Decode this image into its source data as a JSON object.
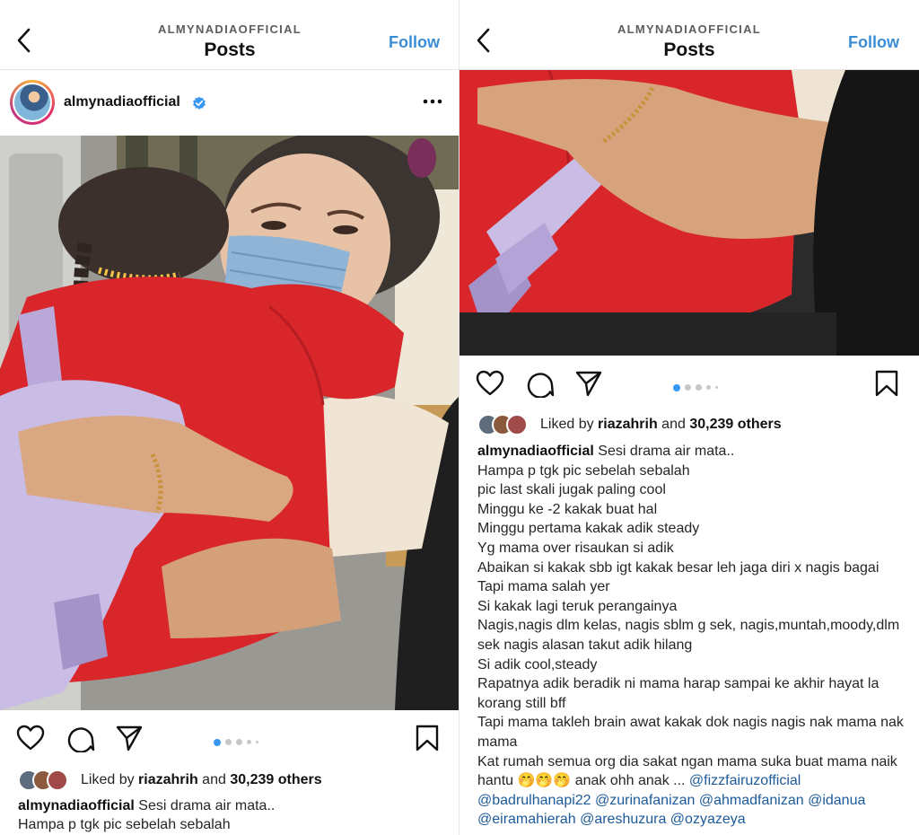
{
  "header": {
    "username": "ALMYNADIAOFFICIAL",
    "title": "Posts",
    "follow_label": "Follow"
  },
  "post": {
    "username": "almynadiaofficial",
    "liked_by_prefix": "Liked by ",
    "liked_by_user": "riazahrih",
    "liked_by_and": " and ",
    "liked_by_count": "30,239 others",
    "carousel": {
      "total": 5,
      "current_left": 1,
      "current_right": 1
    }
  },
  "caption": {
    "username": "almynadiaofficial",
    "lines": [
      "Sesi drama air mata..",
      "Hampa p tgk pic sebelah sebalah",
      "pic last skali jugak paling cool",
      "Minggu ke -2 kakak buat hal",
      "Minggu pertama kakak adik steady",
      "Yg mama over risaukan si adik",
      "Abaikan si kakak sbb igt kakak besar leh jaga diri x nagis bagai",
      "Tapi mama salah yer",
      "Si kakak lagi teruk perangainya",
      "Nagis,nagis dlm kelas, nagis sblm g sek, nagis,muntah,moody,dlm sek nagis alasan takut adik hilang",
      "Si adik cool,steady",
      "Rapatnya adik beradik ni mama harap sampai ke akhir hayat la korang still bff",
      "Tapi mama takleh brain awat kakak dok nagis nagis nak mama nak mama",
      "Kat rumah semua org dia sakat ngan mama suka buat mama naik hantu"
    ],
    "emoji": "🤭🤭🤭",
    "tail": " anak ohh anak ... ",
    "mentions": "@fizzfairuzofficial @badrulhanapi22 @zurinafanizan @ahmadfanizan @idanua @eiramahierah @areshuzura @ozyazeya"
  },
  "colors": {
    "follow": "#3b8ed6",
    "verified": "#3897f0",
    "dot_active": "#3897f0",
    "dot_inactive": "#c7c7c7",
    "mention": "#1d5a9a",
    "shirt_red": "#d8262b",
    "backpack_lilac": "#b9a8d8"
  },
  "icons": [
    "back-arrow-icon",
    "verified-badge-icon",
    "more-options-icon",
    "heart-icon",
    "comment-icon",
    "share-icon",
    "bookmark-icon"
  ]
}
